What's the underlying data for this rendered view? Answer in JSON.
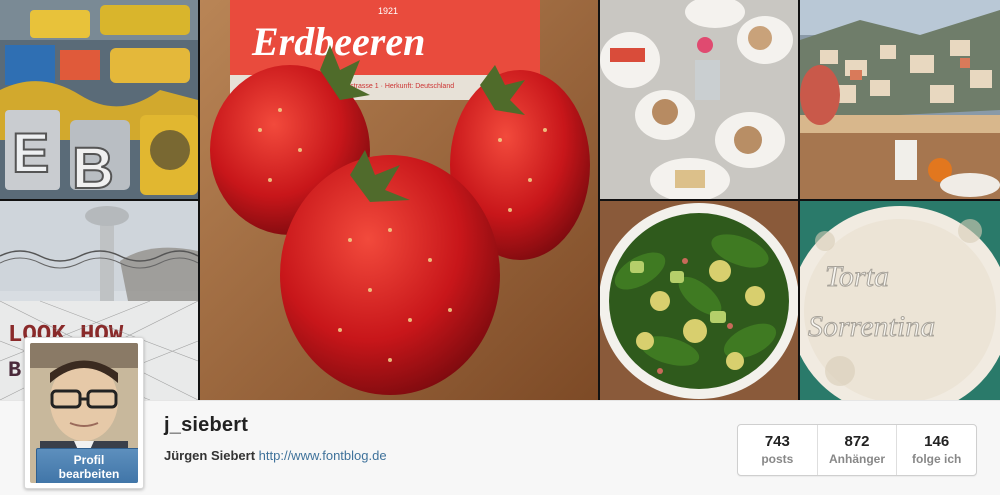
{
  "photos": [
    {
      "name": "photo-letters-signs",
      "alt": ""
    },
    {
      "name": "photo-strawberries",
      "box_brand": "Erdbeeren",
      "box_year": "1921",
      "box_address": "Hansestrasse 1 · Herkunft: Deutschland"
    },
    {
      "name": "photo-cafe-table"
    },
    {
      "name": "photo-positano"
    },
    {
      "name": "photo-tower-graffiti",
      "graffiti_line1": "LOOK HOW",
      "graffiti_line2": "B      TUL"
    },
    {
      "name": "photo-spinach-salad"
    },
    {
      "name": "photo-torta-sorrentina",
      "text_line1": "Torta",
      "text_line2": "Sorrentina"
    }
  ],
  "profile": {
    "username": "j_siebert",
    "full_name": "Jürgen Siebert",
    "website": "http://www.fontblog.de",
    "edit_label_line1": "Profil",
    "edit_label_line2": "bearbeiten"
  },
  "stats": [
    {
      "value": "743",
      "label": "posts"
    },
    {
      "value": "872",
      "label": "Anhänger"
    },
    {
      "value": "146",
      "label": "folge ich"
    }
  ]
}
